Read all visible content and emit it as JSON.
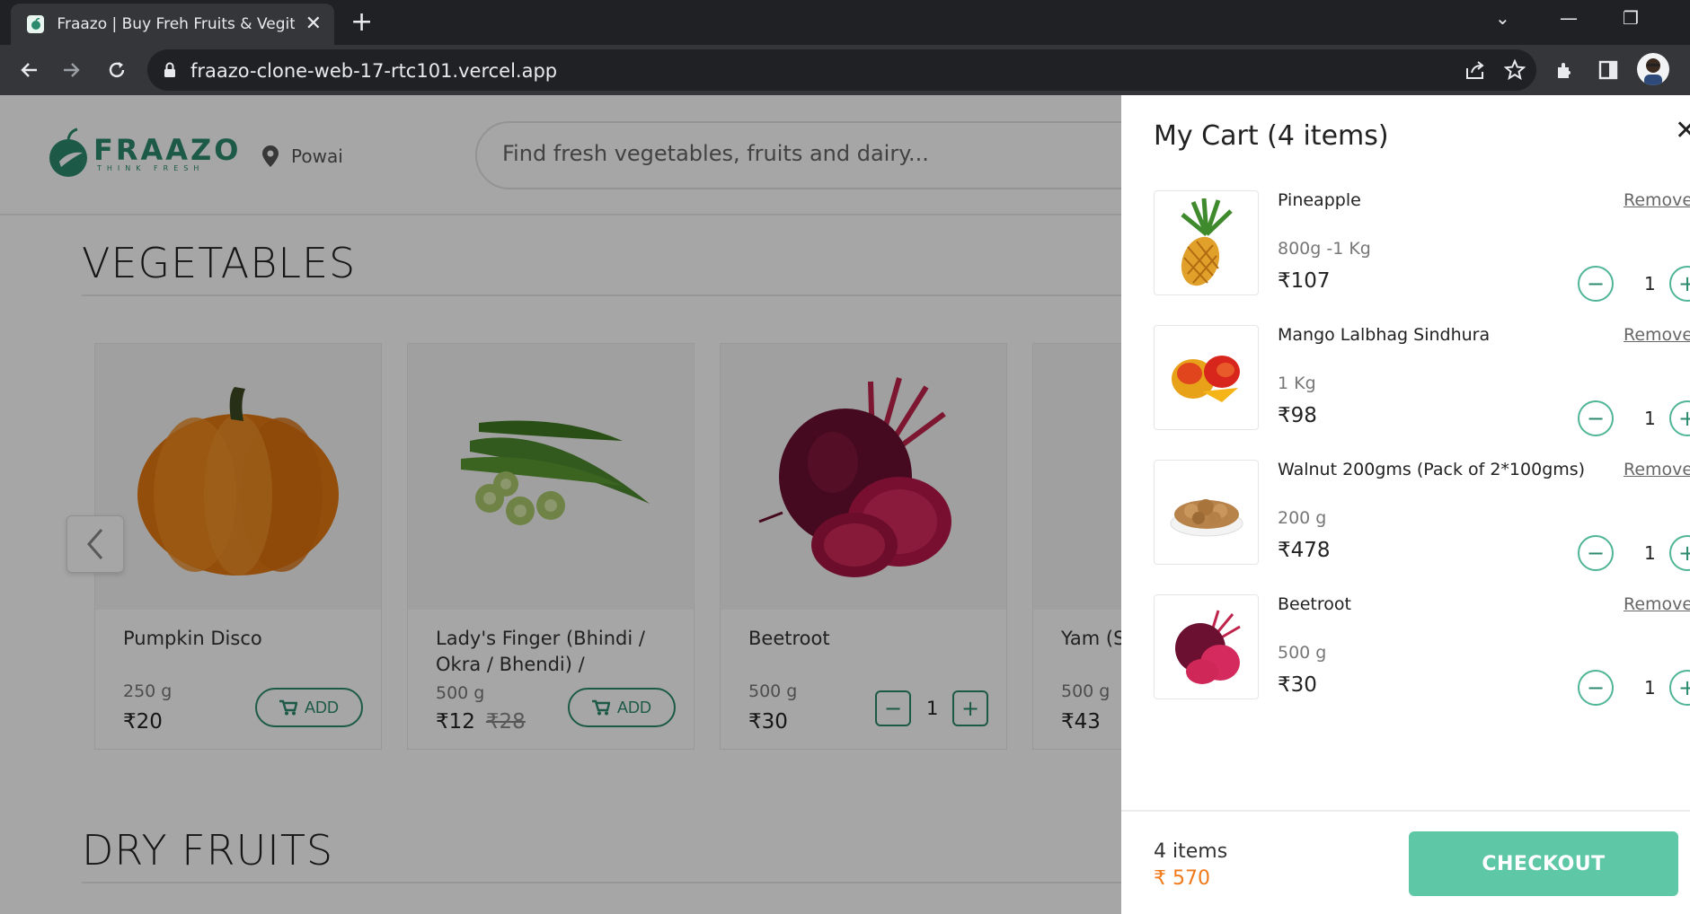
{
  "browser": {
    "tab_title": "Fraazo | Buy Freh Fruits & Vegitables",
    "url": "fraazo-clone-web-17-rtc101.vercel.app"
  },
  "header": {
    "logo_text": "FRAAZO",
    "logo_tagline": "THINK FRESH",
    "location": "Powai",
    "search_placeholder": "Find fresh vegetables, fruits and dairy..."
  },
  "sections": {
    "vegetables_title": "VEGETABLES",
    "dry_fruits_title": "DRY FRUITS"
  },
  "products": [
    {
      "name": "Pumpkin Disco",
      "weight": "250 g",
      "price": "₹20",
      "mrp": "",
      "action": "ADD"
    },
    {
      "name": "Lady's Finger (Bhindi / Okra / Bhendi) /",
      "weight": "500 g",
      "price": "₹12",
      "mrp": "₹28",
      "action": "ADD"
    },
    {
      "name": "Beetroot",
      "weight": "500 g",
      "price": "₹30",
      "mrp": "",
      "qty": "1"
    },
    {
      "name": "Yam (Su",
      "weight": "500 g",
      "price": "₹43",
      "mrp": ""
    }
  ],
  "cart": {
    "title": "My Cart (4 items)",
    "remove_label": "Remove",
    "items": [
      {
        "name": "Pineapple",
        "weight": "800g -1 Kg",
        "price": "₹107",
        "qty": "1"
      },
      {
        "name": "Mango Lalbhag Sindhura",
        "weight": "1 Kg",
        "price": "₹98",
        "qty": "1"
      },
      {
        "name": "Walnut 200gms (Pack of 2*100gms)",
        "weight": "200 g",
        "price": "₹478",
        "qty": "1"
      },
      {
        "name": "Beetroot",
        "weight": "500 g",
        "price": "₹30",
        "qty": "1"
      }
    ],
    "footer_count": "4 items",
    "footer_total": "₹ 570",
    "checkout_label": "CHECKOUT"
  },
  "colors": {
    "brand": "#2b8a6e",
    "checkout": "#5ec7a6",
    "total": "#f07a1a"
  }
}
